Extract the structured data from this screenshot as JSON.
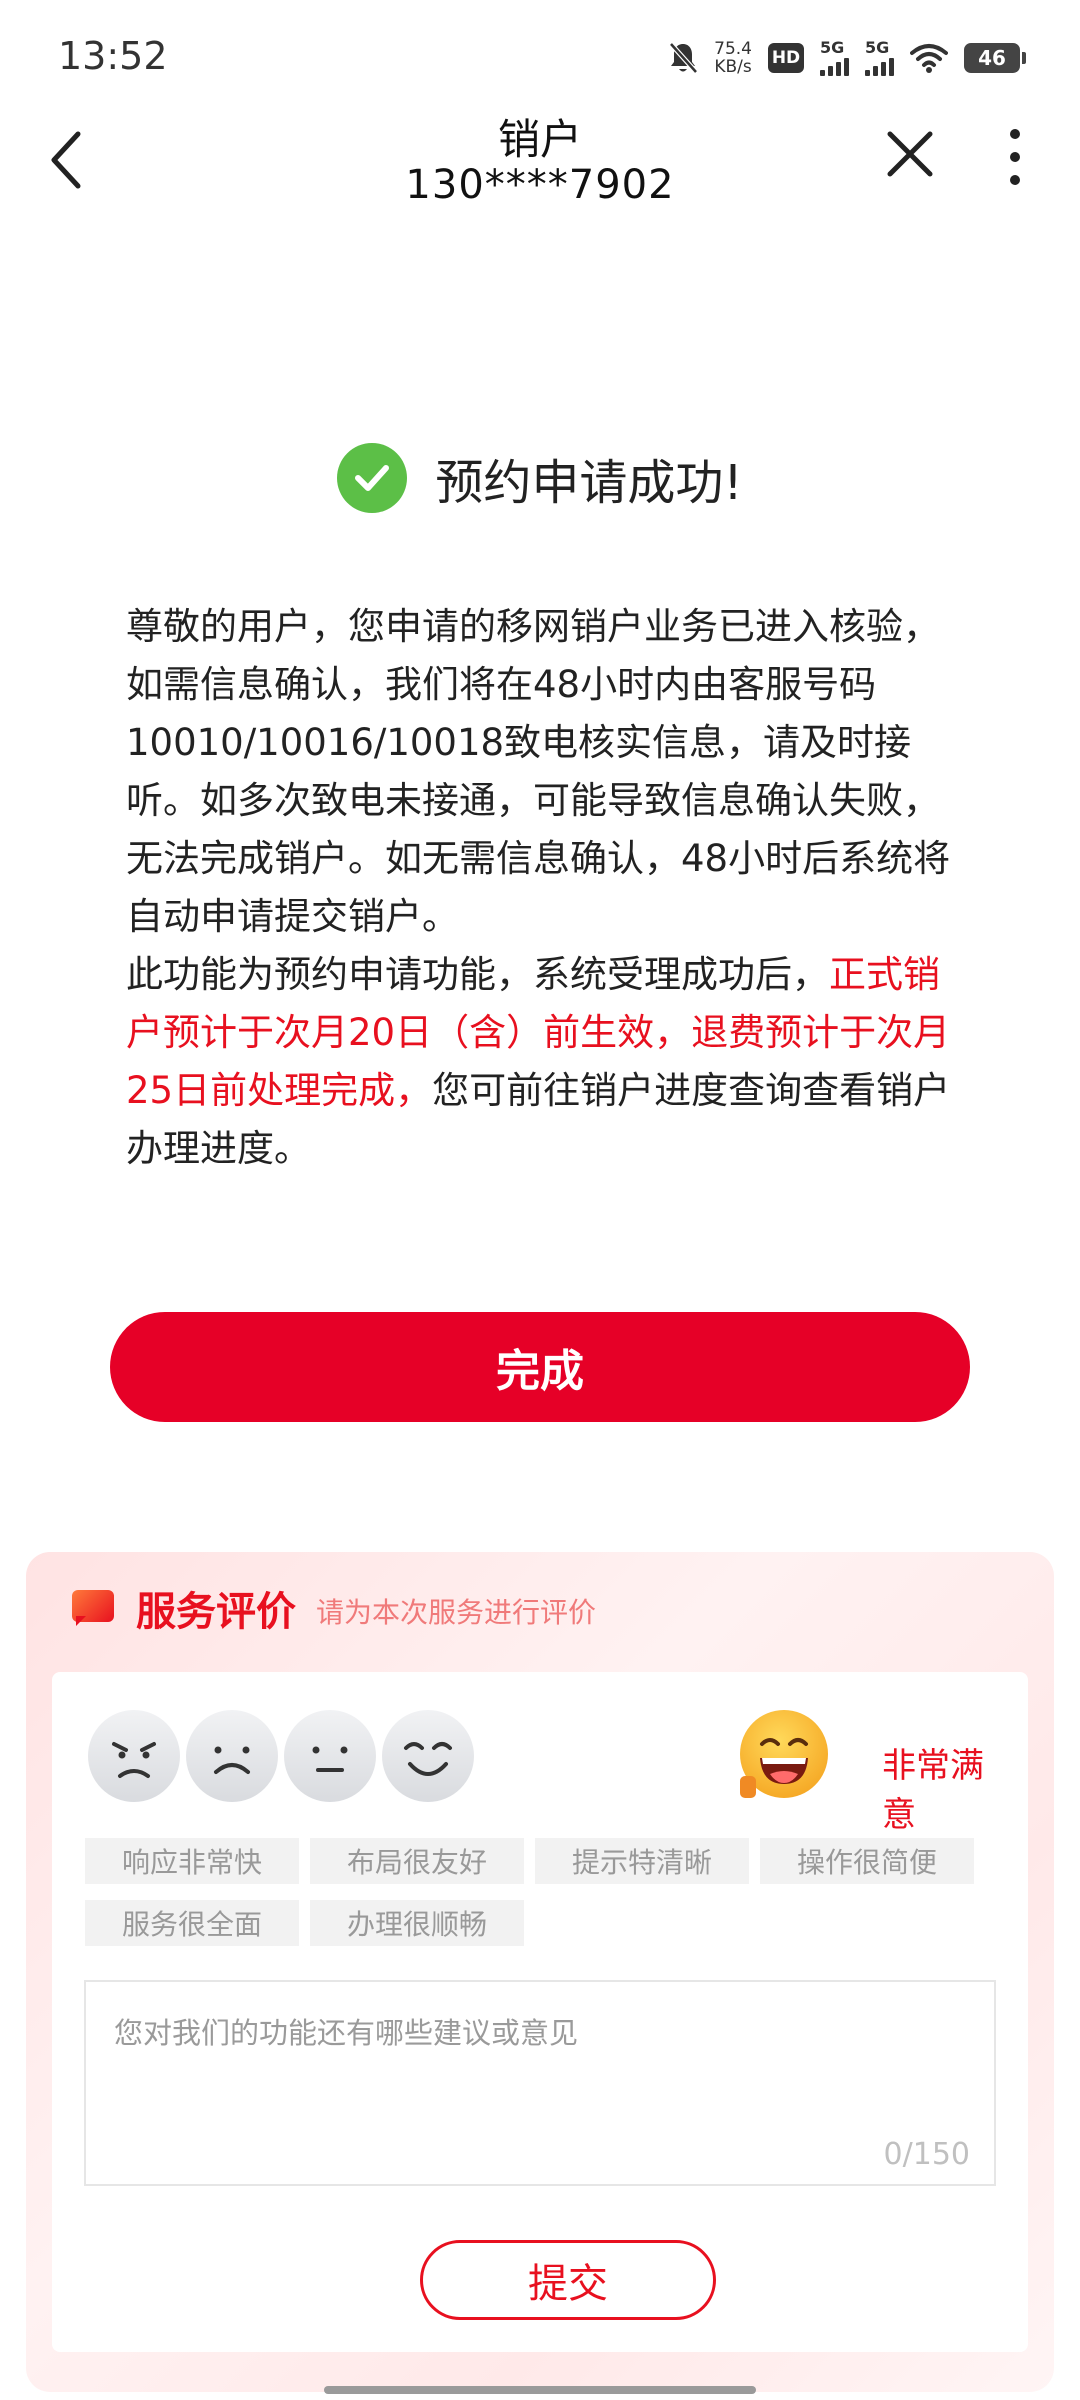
{
  "status_bar": {
    "time": "13:52",
    "net_speed_value": "75.4",
    "net_speed_unit": "KB/s",
    "hd_label": "HD",
    "sim1_label": "5G",
    "sim2_label": "5G",
    "battery": "46",
    "icons": [
      "mute-bell-icon",
      "hd-icon",
      "signal-icon",
      "signal-icon",
      "wifi-icon",
      "battery-icon"
    ]
  },
  "nav": {
    "title": "销户",
    "subtitle": "130****7902",
    "icons": [
      "back-icon",
      "close-icon",
      "more-icon"
    ]
  },
  "result": {
    "title": "预约申请成功!",
    "paragraph1": "尊敬的用户，您申请的移网销户业务已进入核验，如需信息确认，我们将在48小时内由客服号码10010/10016/10018致电核实信息，请及时接听。如多次致电未接通，可能导致信息确认失败，无法完成销户。如无需信息确认，48小时后系统将自动申请提交销户。",
    "paragraph2_normal_start": "此功能为预约申请功能，系统受理成功后，",
    "paragraph2_highlight": "正式销户预计于次月20日（含）前生效，退费预计于次月25日前处理完成，",
    "paragraph2_normal_end": "您可前往销户进度查询查看销户办理进度。",
    "highlight_color": "#e8101f"
  },
  "done_button": "完成",
  "evaluation": {
    "title": "服务评价",
    "hint": "请为本次服务进行评价",
    "selected_label": "非常满意",
    "selected_index": 4,
    "faces": [
      "angry-face-icon",
      "sad-face-icon",
      "neutral-face-icon",
      "smile-face-icon",
      "grin-face-icon"
    ],
    "tags": [
      "响应非常快",
      "布局很友好",
      "提示特清晰",
      "操作很简便",
      "服务很全面",
      "办理很顺畅"
    ],
    "placeholder": "您对我们的功能还有哪些建议或意见",
    "counter": "0/150",
    "submit": "提交"
  },
  "colors": {
    "brand_red": "#e60027",
    "success_green": "#5cbf47"
  }
}
